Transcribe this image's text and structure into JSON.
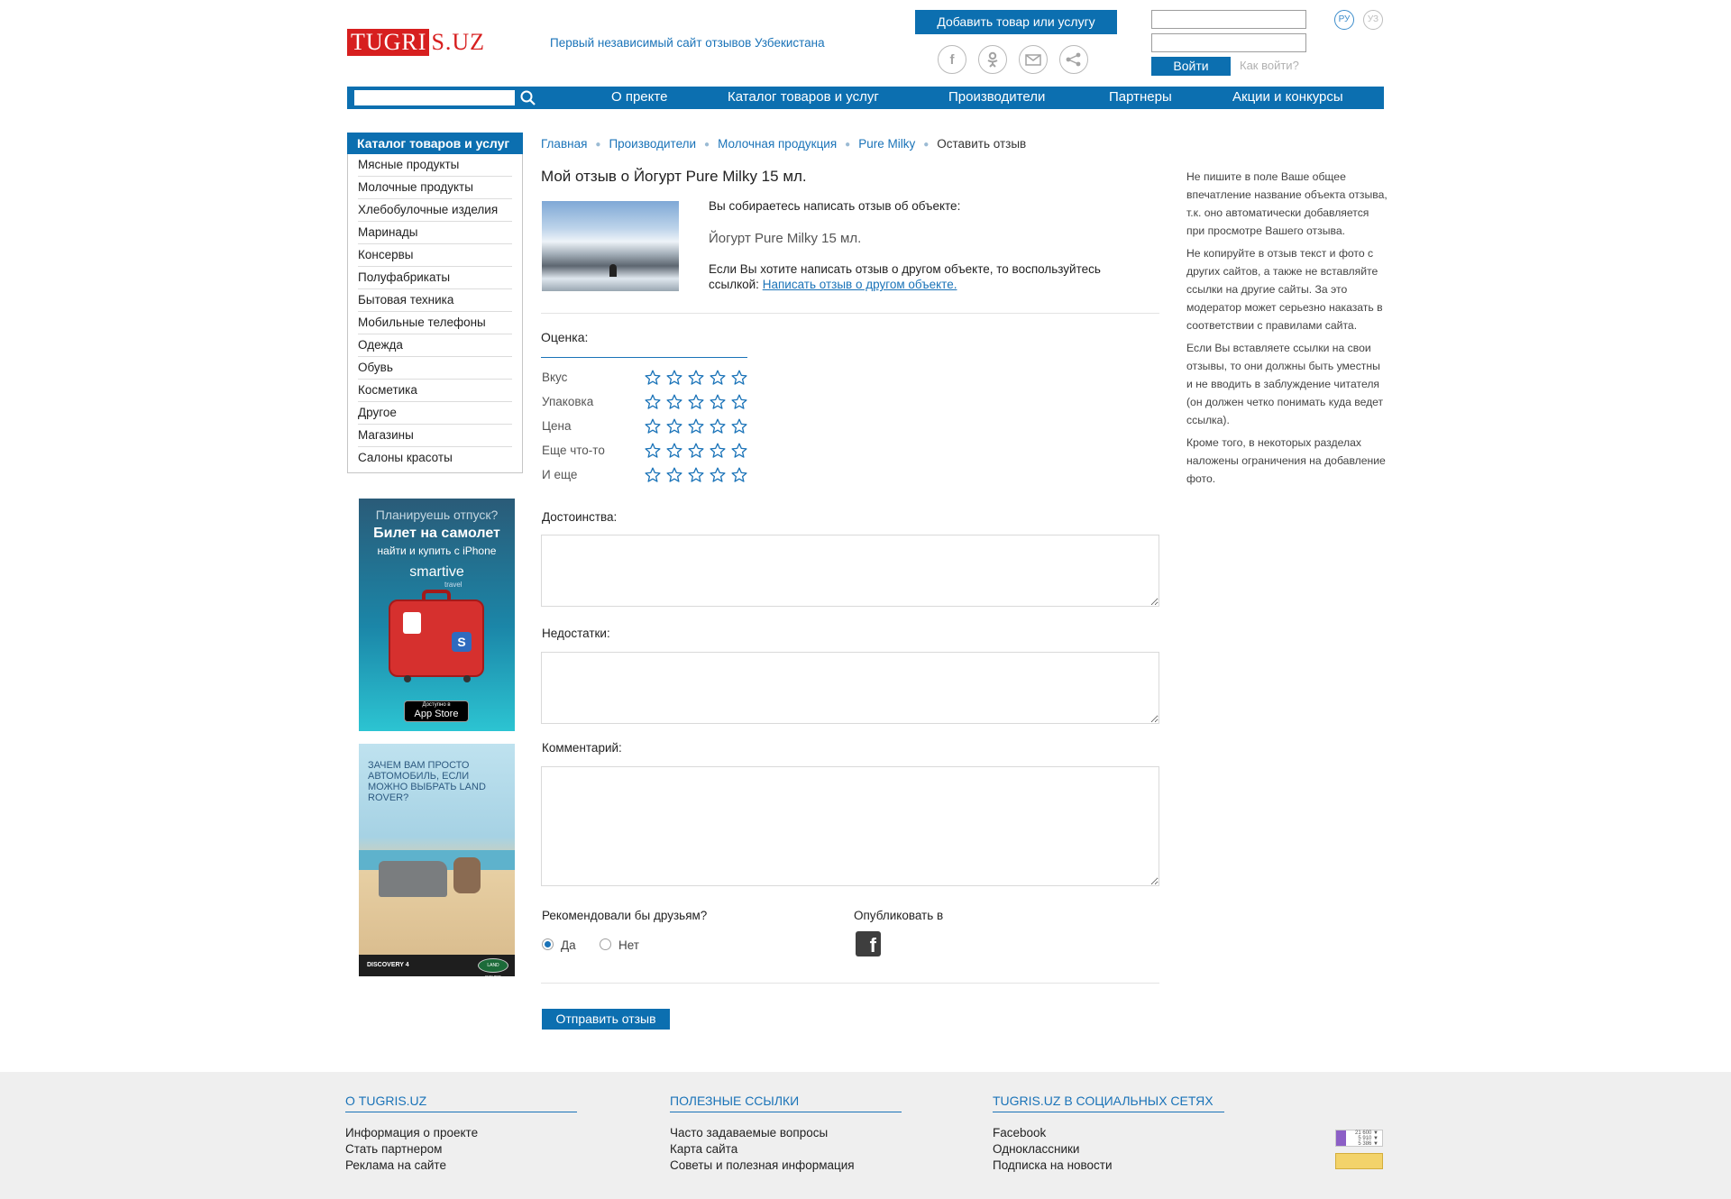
{
  "header": {
    "logo_red": "TUGRI",
    "logo_rest": "S.UZ",
    "tagline": "Первый независимый сайт отзывов Узбекистана",
    "add_button": "Добавить товар или услугу",
    "social_icons": [
      "facebook-icon",
      "odnoklassniki-icon",
      "mail-icon",
      "share-icon"
    ],
    "login_button": "Войти",
    "how_to_login": "Как войти?",
    "lang_ru": "РУ",
    "lang_uz": "УЗ"
  },
  "nav": {
    "items": [
      "О пректе",
      "Каталог товаров и услуг",
      "Производители",
      "Партнеры",
      "Акции и конкурсы"
    ]
  },
  "sidebar": {
    "title": "Каталог товаров и услуг",
    "items": [
      "Мясные продукты",
      "Молочные продукты",
      "Хлебобулочные изделия",
      "Маринады",
      "Консервы",
      "Полуфабрикаты",
      "Бытовая техника",
      "Мобильные телефоны",
      "Одежда",
      "Обувь",
      "Косметика",
      "Другое",
      "Магазины",
      "Салоны красоты"
    ]
  },
  "ad1": {
    "line1": "Планируешь отпуск?",
    "line2": "Билет на самолет",
    "line3": "найти и купить с iPhone",
    "brand": "smartive",
    "brand_sub": "travel",
    "store_small": "Доступно в",
    "store": "App Store"
  },
  "ad2": {
    "text": "ЗАЧЕМ ВАМ ПРОСТО АВТОМОБИЛЬ, ЕСЛИ МОЖНО ВЫБРАТЬ LAND ROVER?",
    "model": "DISCOVERY 4",
    "logo": "LAND ROVER"
  },
  "breadcrumb": {
    "items": [
      "Главная",
      "Производители",
      "Молочная продукция",
      "Pure Milky"
    ],
    "current": "Оставить отзыв"
  },
  "main": {
    "title": "Мой отзыв о Йогурт Pure Milky 15 мл.",
    "intro": "Вы собираетесь написать отзыв об объекте:",
    "object_name": "Йогурт Pure Milky 15 мл.",
    "other_text": "Если Вы хотите написать отзыв о другом объекте, то воспользуйтесь ссылкой:",
    "other_link": "Написать отзыв о другом объекте.",
    "rating_label": "Оценка:",
    "criteria": [
      {
        "label": "Вкус",
        "stars": 0
      },
      {
        "label": "Упаковка",
        "stars": 0
      },
      {
        "label": "Цена",
        "stars": 0
      },
      {
        "label": "Еще что-то",
        "stars": 0
      },
      {
        "label": "И еще",
        "stars": 0
      }
    ],
    "pros_label": "Достоинства:",
    "cons_label": "Недостатки:",
    "comment_label": "Комментарий:",
    "recommend_label": "Рекомендовали бы друзьям?",
    "yes": "Да",
    "no": "Нет",
    "recommend_value": "Да",
    "publish_label": "Опубликовать в",
    "submit": "Отправить отзыв"
  },
  "tips": [
    "Не пишите в поле Ваше общее впечатление название объекта отзыва, т.к. оно автоматически добавляется при просмотре Вашего отзыва.",
    "Не копируйте в отзыв текст и фото с других сайтов, а также не вставляйте ссылки на другие сайты. За это модератор может серьезно наказать в соответствии с правилами сайта.",
    "Если Вы вставляете ссылки на свои отзывы, то они должны быть уместны и не вводить в заблуждение читателя (он должен четко понимать куда ведет ссылка).",
    "Кроме того, в некоторых разделах наложены ограничения на добавление фото."
  ],
  "footer": {
    "col1": {
      "title": "О TUGRIS.UZ",
      "links": [
        "Информация о проекте",
        "Стать партнером",
        "Реклама на сайте"
      ]
    },
    "col2": {
      "title": "ПОЛЕЗНЫЕ ССЫЛКИ",
      "links": [
        "Часто задаваемые вопросы",
        "Карта сайта",
        "Советы и полезная информация"
      ]
    },
    "col3": {
      "title": "TUGRIS.UZ В СОЦИАЛЬНЫХ СЕТЯХ",
      "links": [
        "Facebook",
        "Одноклассники",
        "Подписка на новости"
      ]
    },
    "counter_values": [
      "21 600 ▼",
      "5 910 ▼",
      "5 386 ▼"
    ]
  },
  "colors": {
    "accent": "#0c6fb0",
    "logo_red": "#d71f1f",
    "link": "#1a73b8"
  }
}
